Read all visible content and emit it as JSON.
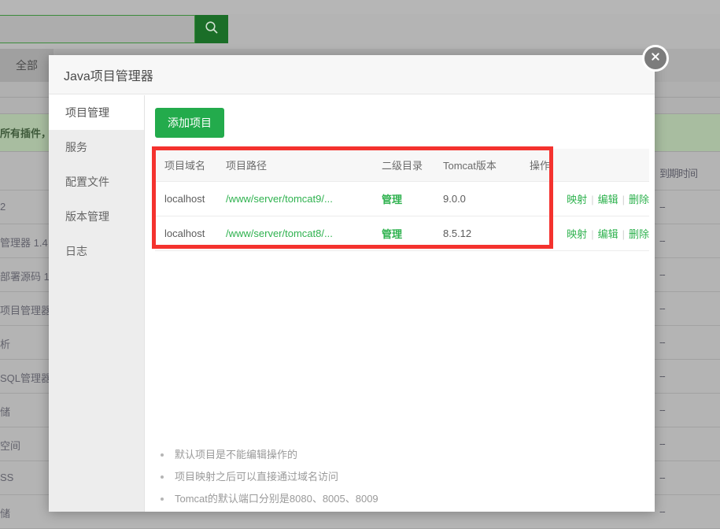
{
  "background": {
    "search": {
      "placeholder": "search",
      "value": "",
      "icon": "search-icon"
    },
    "tab_all": "全部",
    "banner_text": "所有插件，",
    "right_column_header": "到期时间",
    "rows": [
      {
        "left": "2",
        "right": "--"
      },
      {
        "left": "管理器 1.4",
        "right": "--"
      },
      {
        "left": "部署源码 1",
        "right": "--"
      },
      {
        "left": "项目管理器",
        "right": "--"
      },
      {
        "left": "析",
        "right": "--"
      },
      {
        "left": "SQL管理器",
        "right": "--"
      },
      {
        "left": "储",
        "right": "--"
      },
      {
        "left": "空间",
        "right": "--"
      },
      {
        "left": "SS",
        "right": "--"
      },
      {
        "left": "储",
        "right": "--"
      }
    ]
  },
  "dialog": {
    "title": "Java项目管理器",
    "close_icon": "close-icon",
    "sidebar": [
      {
        "label": "项目管理",
        "active": true
      },
      {
        "label": "服务",
        "active": false
      },
      {
        "label": "配置文件",
        "active": false
      },
      {
        "label": "版本管理",
        "active": false
      },
      {
        "label": "日志",
        "active": false
      }
    ],
    "add_button": "添加项目",
    "table": {
      "columns": [
        "项目域名",
        "项目路径",
        "二级目录",
        "Tomcat版本",
        "操作"
      ],
      "rows": [
        {
          "domain": "localhost",
          "path": "/www/server/tomcat9/...",
          "subdir": "管理",
          "tomcat_version": "9.0.0",
          "actions": [
            "映射",
            "编辑",
            "删除"
          ]
        },
        {
          "domain": "localhost",
          "path": "/www/server/tomcat8/...",
          "subdir": "管理",
          "tomcat_version": "8.5.12",
          "actions": [
            "映射",
            "编辑",
            "删除"
          ]
        }
      ]
    },
    "notes": [
      "默认项目是不能编辑操作的",
      "项目映射之后可以直接通过域名访问",
      "Tomcat的默认端口分别是8080、8005、8009"
    ]
  },
  "colors": {
    "accent_green": "#23ab4c",
    "link_green": "#2fb24f",
    "annotation_red": "#f4322e",
    "search_button_green": "#1b6e28"
  }
}
